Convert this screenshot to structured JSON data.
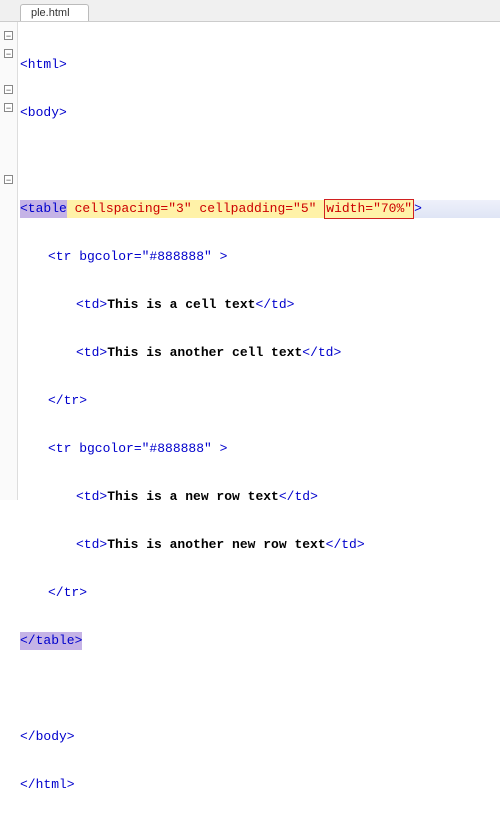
{
  "tab": {
    "filename": "ple.html"
  },
  "code": {
    "l1_open": "<html>",
    "l2_open": "<body>",
    "blank": "",
    "table_open_tag": "<table",
    "table_attrs_a": " cellspacing=\"3\" cellpadding=\"5\" ",
    "table_attrs_b": "width=\"70%\"",
    "table_open_end": ">",
    "tr_open": "<tr bgcolor=\"#888888\" >",
    "td_open": "<td>",
    "td_close": "</td>",
    "cell1": "This is a cell text",
    "cell2": "This is another cell text",
    "tr_close": "</tr>",
    "cell3": "This is a new row text",
    "cell4": "This is another new row text",
    "table_close": "</table>",
    "body_close": "</body>",
    "html_close": "</html>"
  }
}
